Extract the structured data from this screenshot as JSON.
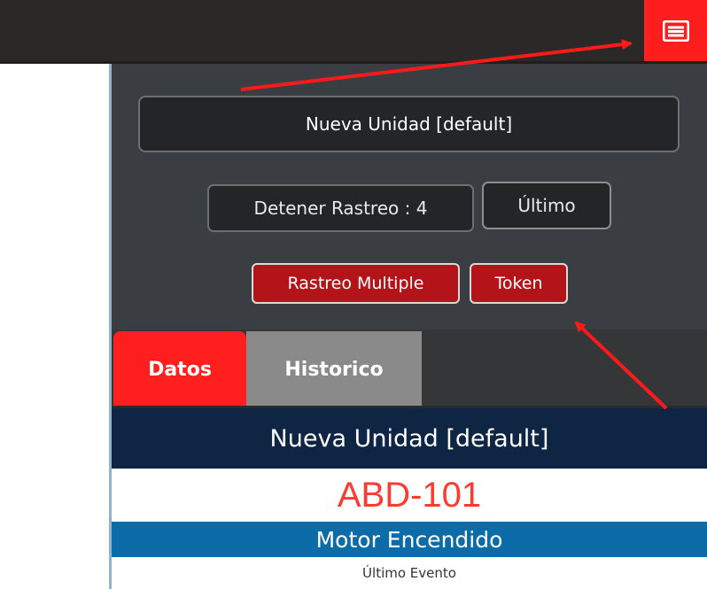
{
  "topbar": {
    "menu_icon": "list-icon",
    "menu_color": "#ff1e1e"
  },
  "panel": {
    "unit_name": "Nueva Unidad [default]",
    "detener_label": "Detener Rastreo : 4",
    "ultimo_label": "Último",
    "rastreo_multiple_label": "Rastreo Multiple",
    "token_label": "Token"
  },
  "tabs": [
    {
      "label": "Datos",
      "active": true
    },
    {
      "label": "Historico",
      "active": false
    }
  ],
  "details": {
    "unit_name": "Nueva Unidad [default]",
    "plate": "ABD-101",
    "status": "Motor Encendido",
    "last_event_label": "Último Evento"
  },
  "annotations": {
    "arrow_color": "#ff1a1a",
    "arrows": [
      "arrow-to-menu",
      "arrow-to-token"
    ]
  }
}
